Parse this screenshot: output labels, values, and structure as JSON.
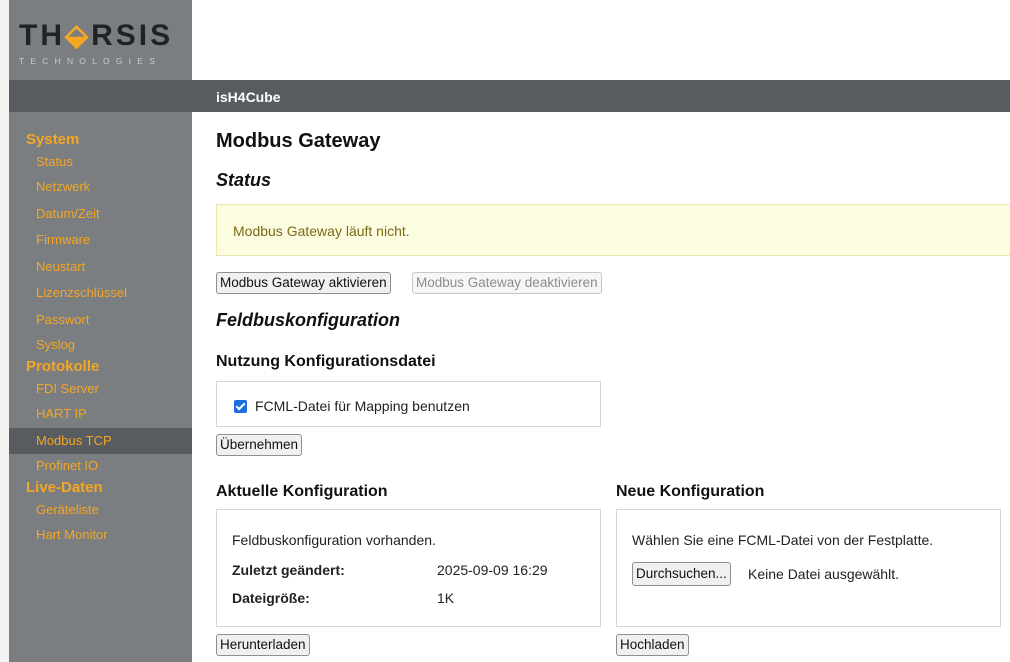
{
  "logo": {
    "brand_pre": "TH",
    "brand_glyph": "⬙",
    "brand_post": "RSIS",
    "tagline": "TECHNOLOGIES"
  },
  "header": {
    "device_name": "isH4Cube"
  },
  "sidebar": {
    "sections": [
      {
        "label": "System",
        "items": [
          "Status",
          "Netzwerk",
          "Datum/Zeit",
          "Firmware",
          "Neustart",
          "Lizenzschlüssel",
          "Passwort",
          "Syslog"
        ]
      },
      {
        "label": "Protokolle",
        "items": [
          "FDI Server",
          "HART IP",
          "Modbus TCP",
          "Profinet IO"
        ]
      },
      {
        "label": "Live-Daten",
        "items": [
          "Geräteliste",
          "Hart Monitor"
        ]
      }
    ],
    "active_item": "Modbus TCP"
  },
  "main": {
    "page_title": "Modbus Gateway",
    "status_heading": "Status",
    "status_message": "Modbus Gateway läuft nicht.",
    "activate_button": "Modbus Gateway aktivieren",
    "deactivate_button": "Modbus Gateway deaktivieren",
    "fieldbus_heading": "Feldbuskonfiguration",
    "usage_heading": "Nutzung Konfigurationsdatei",
    "fcml_checkbox_label": "FCML-Datei für Mapping benutzen",
    "fcml_checkbox_checked": true,
    "apply_button": "Übernehmen",
    "current_config": {
      "heading": "Aktuelle Konfiguration",
      "status_text": "Feldbuskonfiguration vorhanden.",
      "last_changed_label": "Zuletzt geändert:",
      "last_changed_value": "2025-09-09 16:29",
      "file_size_label": "Dateigröße:",
      "file_size_value": "1K",
      "download_button": "Herunterladen"
    },
    "new_config": {
      "heading": "Neue Konfiguration",
      "instruction": "Wählen Sie eine FCML-Datei von der Festplatte.",
      "browse_button": "Durchsuchen...",
      "no_file_text": "Keine Datei ausgewählt.",
      "upload_button": "Hochladen"
    }
  },
  "colors": {
    "accent": "#f5a623",
    "sidebar_bg": "#7b7e81",
    "bar_bg": "#585c60",
    "alert_bg": "#fcfce0"
  }
}
